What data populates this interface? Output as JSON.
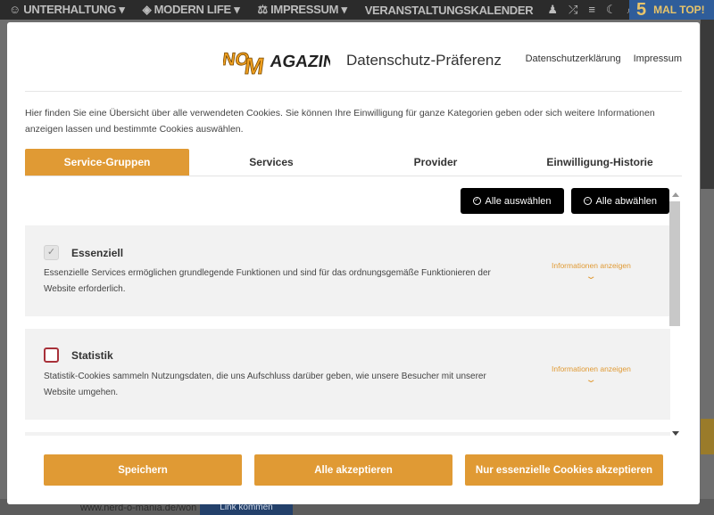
{
  "background": {
    "nav_items": [
      "UNTERHALTUNG",
      "MODERN LIFE",
      "IMPRESSUM",
      "VERANSTALTUNGSKALENDER"
    ],
    "promo_number": "5",
    "promo_text": "MAL TOP!",
    "footer_url": "www.nerd-o-mania.de/won",
    "footer_button": "Link kommen"
  },
  "modal": {
    "logo_text": "NOMAGAZIN",
    "title": "Datenschutz-Präferenz",
    "header_links": [
      "Datenschutzerklärung",
      "Impressum"
    ],
    "intro": "Hier finden Sie eine Übersicht über alle verwendeten Cookies. Sie können Ihre Einwilligung für ganze Kategorien geben oder sich weitere Informationen anzeigen lassen und bestimmte Cookies auswählen.",
    "tabs": [
      "Service-Gruppen",
      "Services",
      "Provider",
      "Einwilligung-Historie"
    ],
    "active_tab": "Service-Gruppen",
    "select_all": "Alle auswählen",
    "deselect_all": "Alle abwählen",
    "groups": [
      {
        "name": "Essenziell",
        "checked": true,
        "description": "Essenzielle Services ermöglichen grundlegende Funktionen und sind für das ordnungsgemäße Funktionieren der Website erforderlich.",
        "info_link": "Informationen anzeigen"
      },
      {
        "name": "Statistik",
        "checked": false,
        "description": "Statistik-Cookies sammeln Nutzungsdaten, die uns Aufschluss darüber geben, wie unsere Besucher mit unserer Website umgehen.",
        "info_link": "Informationen anzeigen"
      }
    ],
    "footer_buttons": [
      "Speichern",
      "Alle akzeptieren",
      "Nur essenzielle Cookies akzeptieren"
    ]
  },
  "colors": {
    "accent": "#e09a34",
    "dark_button": "#000000",
    "unchecked_border": "#a8313a"
  }
}
